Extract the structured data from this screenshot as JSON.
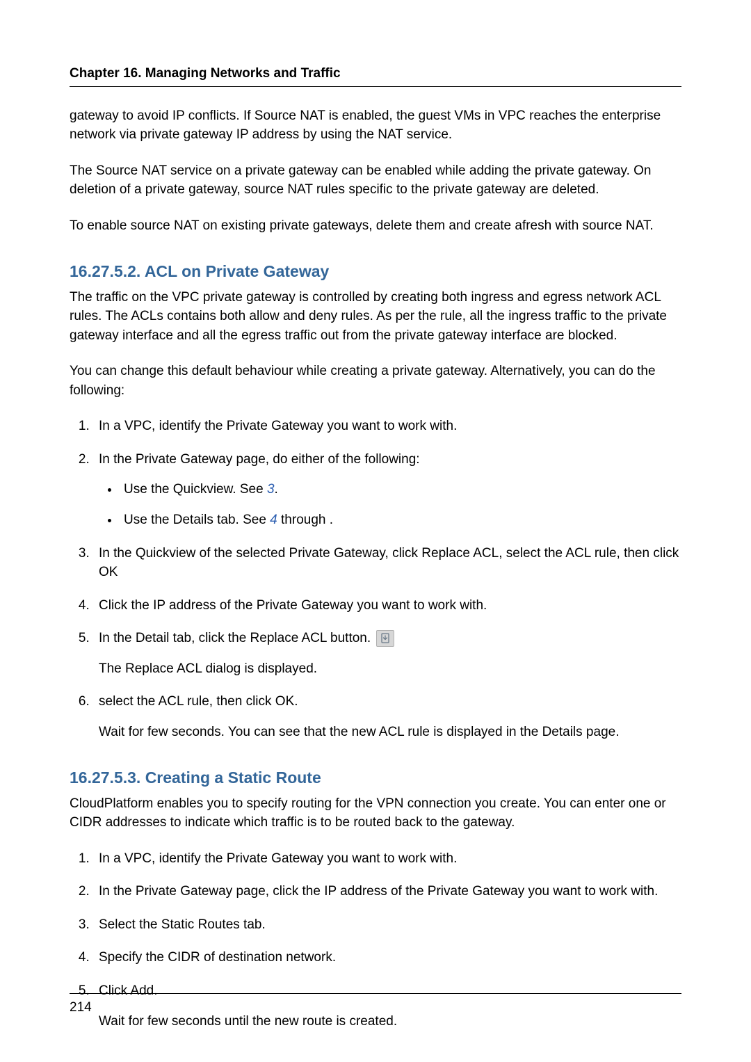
{
  "header": {
    "chapter": "Chapter 16. Managing Networks and Traffic"
  },
  "intro": {
    "p1": "gateway to avoid IP conflicts. If Source NAT is enabled, the guest VMs in VPC reaches the enterprise network via private gateway IP address by using the NAT service.",
    "p2": "The Source NAT service on a private gateway can be enabled while adding the private gateway. On deletion of a private gateway, source NAT rules specific to the private gateway are deleted.",
    "p3": "To enable source NAT on existing private gateways, delete them and create afresh with source NAT."
  },
  "sec1": {
    "title": "16.27.5.2. ACL on Private Gateway",
    "p1": "The traffic on the VPC private gateway is controlled by creating both ingress and egress network ACL rules. The ACLs contains both allow and deny rules. As per the rule, all the ingress traffic to the private gateway interface and all the egress traffic out from the private gateway interface are blocked.",
    "p2": "You can change this default behaviour while creating a private gateway. Alternatively, you can do the following:",
    "steps": {
      "s1": "In a VPC, identify the Private Gateway you want to work with.",
      "s2": "In the Private Gateway page, do either of the following:",
      "s2a_pre": "Use the Quickview. See ",
      "s2a_link": "3",
      "s2a_post": ".",
      "s2b_pre": "Use the Details tab. See ",
      "s2b_link": "4",
      "s2b_post": " through .",
      "s3": "In the Quickview of the selected Private Gateway, click Replace ACL, select the ACL rule, then click OK",
      "s4": "Click the IP address of the Private Gateway you want to work with.",
      "s5a": "In the Detail tab, click the Replace ACL button.",
      "s5b": "The Replace ACL dialog is displayed.",
      "s6a": "select the ACL rule, then click OK.",
      "s6b": "Wait for few seconds. You can see that the new ACL rule is displayed in the Details page."
    }
  },
  "sec2": {
    "title": "16.27.5.3. Creating a Static Route",
    "p1": "CloudPlatform enables you to specify routing for the VPN connection you create. You can enter one or CIDR addresses to indicate which traffic is to be routed back to the gateway.",
    "steps": {
      "s1": "In a VPC, identify the Private Gateway you want to work with.",
      "s2": "In the Private Gateway page, click the IP address of the Private Gateway you want to work with.",
      "s3": "Select the Static Routes tab.",
      "s4": "Specify the CIDR of destination network.",
      "s5a": "Click Add.",
      "s5b": "Wait for few seconds until the new route is created."
    }
  },
  "footer": {
    "page": "214"
  }
}
